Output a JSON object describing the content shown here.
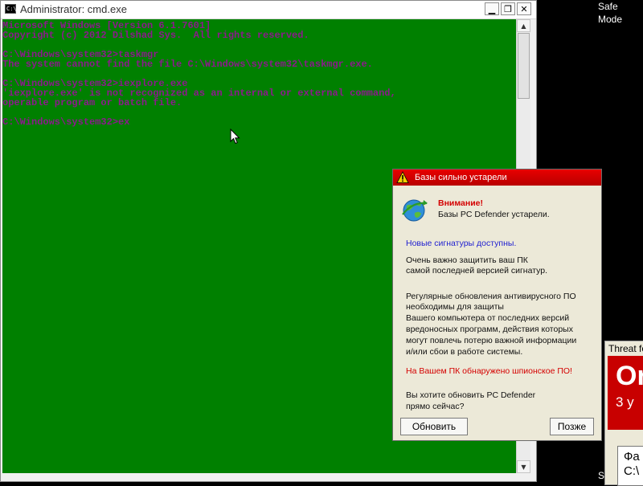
{
  "cmd": {
    "title": "Administrator: cmd.exe",
    "icon_text": "C:\\",
    "buttons": {
      "minimize": "▁",
      "maximize": "❐",
      "close": "✕"
    },
    "lines": [
      "Microsoft Windows [Version 6.1.7601]",
      "Copyright (c) 2012 Dilshad Sys.  All rights reserved.",
      "",
      "C:\\Windows\\system32>taskmgr",
      "The system cannot find the file C:\\Windows\\system32\\taskmgr.exe.",
      "",
      "C:\\Windows\\system32>iexplore.exe",
      "'iexplore.exe' is not recognized as an internal or external command,",
      "operable program or batch file.",
      "",
      "C:\\Windows\\system32>ex"
    ],
    "colors": {
      "background": "#008000",
      "text": "#8b1a8b"
    }
  },
  "safe_mode_label": "Safe Mode",
  "av_dialog": {
    "title": "Базы сильно устарели",
    "attention": "Внимание!",
    "db_outdated": "Базы PC Defender устарели.",
    "new_signatures": "Новые сигнатуры доступны.",
    "important_1": "Очень важно защитить ваш ПК",
    "important_2": "самой последней версией сигнатур.",
    "para": [
      "Регулярные обновления антивирусного ПО",
      "необходимы для защиты",
      "Вашего компьютера от последних версий",
      "вредоносных программ, действия которых",
      "могут повлечь потерю важной информации",
      "и/или сбои в работе системы."
    ],
    "spyware_found": "На Вашем ПК обнаружено шпионское ПО!",
    "question_1": "Вы хотите обновить PC Defender",
    "question_2": "прямо сейчас?",
    "update_button": "Обновить",
    "later_button": "Позже",
    "colors": {
      "titlebar": "#d40000",
      "warning": "#d40000",
      "link": "#1f1fd0"
    }
  },
  "threat_window": {
    "title": "Threat fo",
    "big_text": "Or",
    "sub_text": "3  y",
    "box_line1": "Фа",
    "box_line2": "C:\\"
  },
  "bottom_letter": "S"
}
